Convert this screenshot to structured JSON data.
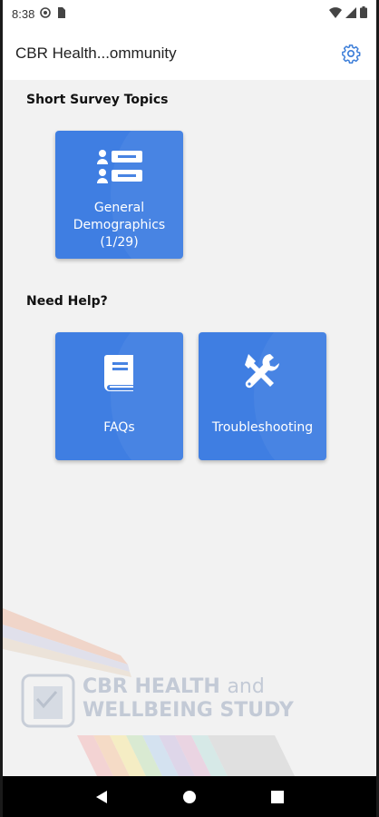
{
  "status_bar": {
    "time": "8:38",
    "icons_left": [
      "gear-circle-icon",
      "sim-card-icon"
    ],
    "icons_right": [
      "wifi-icon",
      "signal-icon",
      "battery-icon"
    ]
  },
  "app_bar": {
    "title": "CBR Health...ommunity",
    "settings_icon": "gear-icon"
  },
  "sections": {
    "survey": {
      "title": "Short Survey Topics",
      "tiles": [
        {
          "label_line1": "General",
          "label_line2": "Demographics",
          "progress": "(1/29)",
          "icon": "form-list-icon"
        }
      ]
    },
    "help": {
      "title": "Need Help?",
      "tiles": [
        {
          "label": "FAQs",
          "icon": "book-icon"
        },
        {
          "label": "Troubleshooting",
          "icon": "tools-icon"
        }
      ]
    }
  },
  "branding": {
    "line1_bold": "CBR HEALTH",
    "line1_light": "and",
    "line2": "WELLBEING STUDY"
  },
  "colors": {
    "tile_blue": "#3f7ee2",
    "accent_blue": "#3b7dd8",
    "background": "#f2f2f2"
  }
}
